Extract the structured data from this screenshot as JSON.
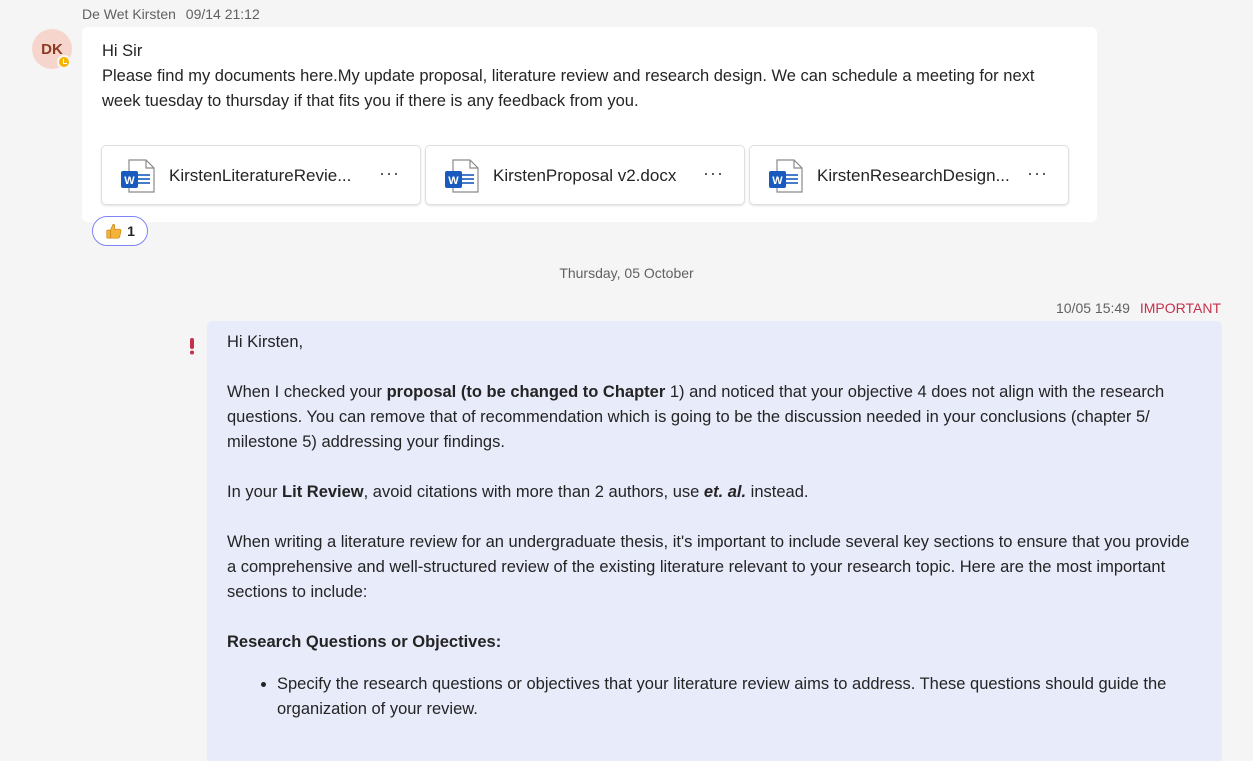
{
  "incoming": {
    "sender": "De Wet Kirsten",
    "timestamp": "09/14 21:12",
    "avatar_initials": "DK",
    "lines": [
      "Hi Sir",
      "Please find my documents here.My update proposal, literature review and research design. We can schedule a meeting for next week tuesday to thursday if that fits you if there is any feedback from you."
    ],
    "attachments": [
      {
        "name": "KirstenLiteratureRevie...",
        "icon": "word-icon"
      },
      {
        "name": "KirstenProposal v2.docx",
        "icon": "word-icon"
      },
      {
        "name": "KirstenResearchDesign...",
        "icon": "word-icon"
      }
    ],
    "reaction": {
      "icon": "thumbs-up-icon",
      "count": "1"
    }
  },
  "date_divider": "Thursday, 05 October",
  "outgoing": {
    "timestamp": "10/05 15:49",
    "importance": "IMPORTANT",
    "greeting": "Hi Kirsten,",
    "p1_pre": "When I checked your ",
    "p1_bold": "proposal (to be changed to Chapter",
    "p1_post": " 1) and noticed that your objective 4 does not align with the research questions. You can remove that of recommendation which is going to be the discussion needed in your conclusions (chapter 5/ milestone 5) addressing your findings.",
    "p2_pre": "In your ",
    "p2_bold": "Lit Review",
    "p2_mid": ", avoid citations with more than 2 authors, use ",
    "p2_bolditalic": "et. al.",
    "p2_post": " instead.",
    "p3": "When writing a literature review for an undergraduate thesis, it's important to include several key sections to ensure that you provide a comprehensive and well-structured review of the existing literature relevant to your research topic. Here are the most important sections to include:",
    "section_heading": "Research Questions or Objectives:",
    "bullets": [
      "Specify the research questions or objectives that your literature review aims to address. These questions should guide the organization of your review."
    ]
  },
  "colors": {
    "background": "#f5f5f5",
    "incoming_bubble": "#ffffff",
    "outgoing_bubble": "#e8ebfa",
    "important": "#c4314b",
    "word_blue": "#185abd"
  }
}
